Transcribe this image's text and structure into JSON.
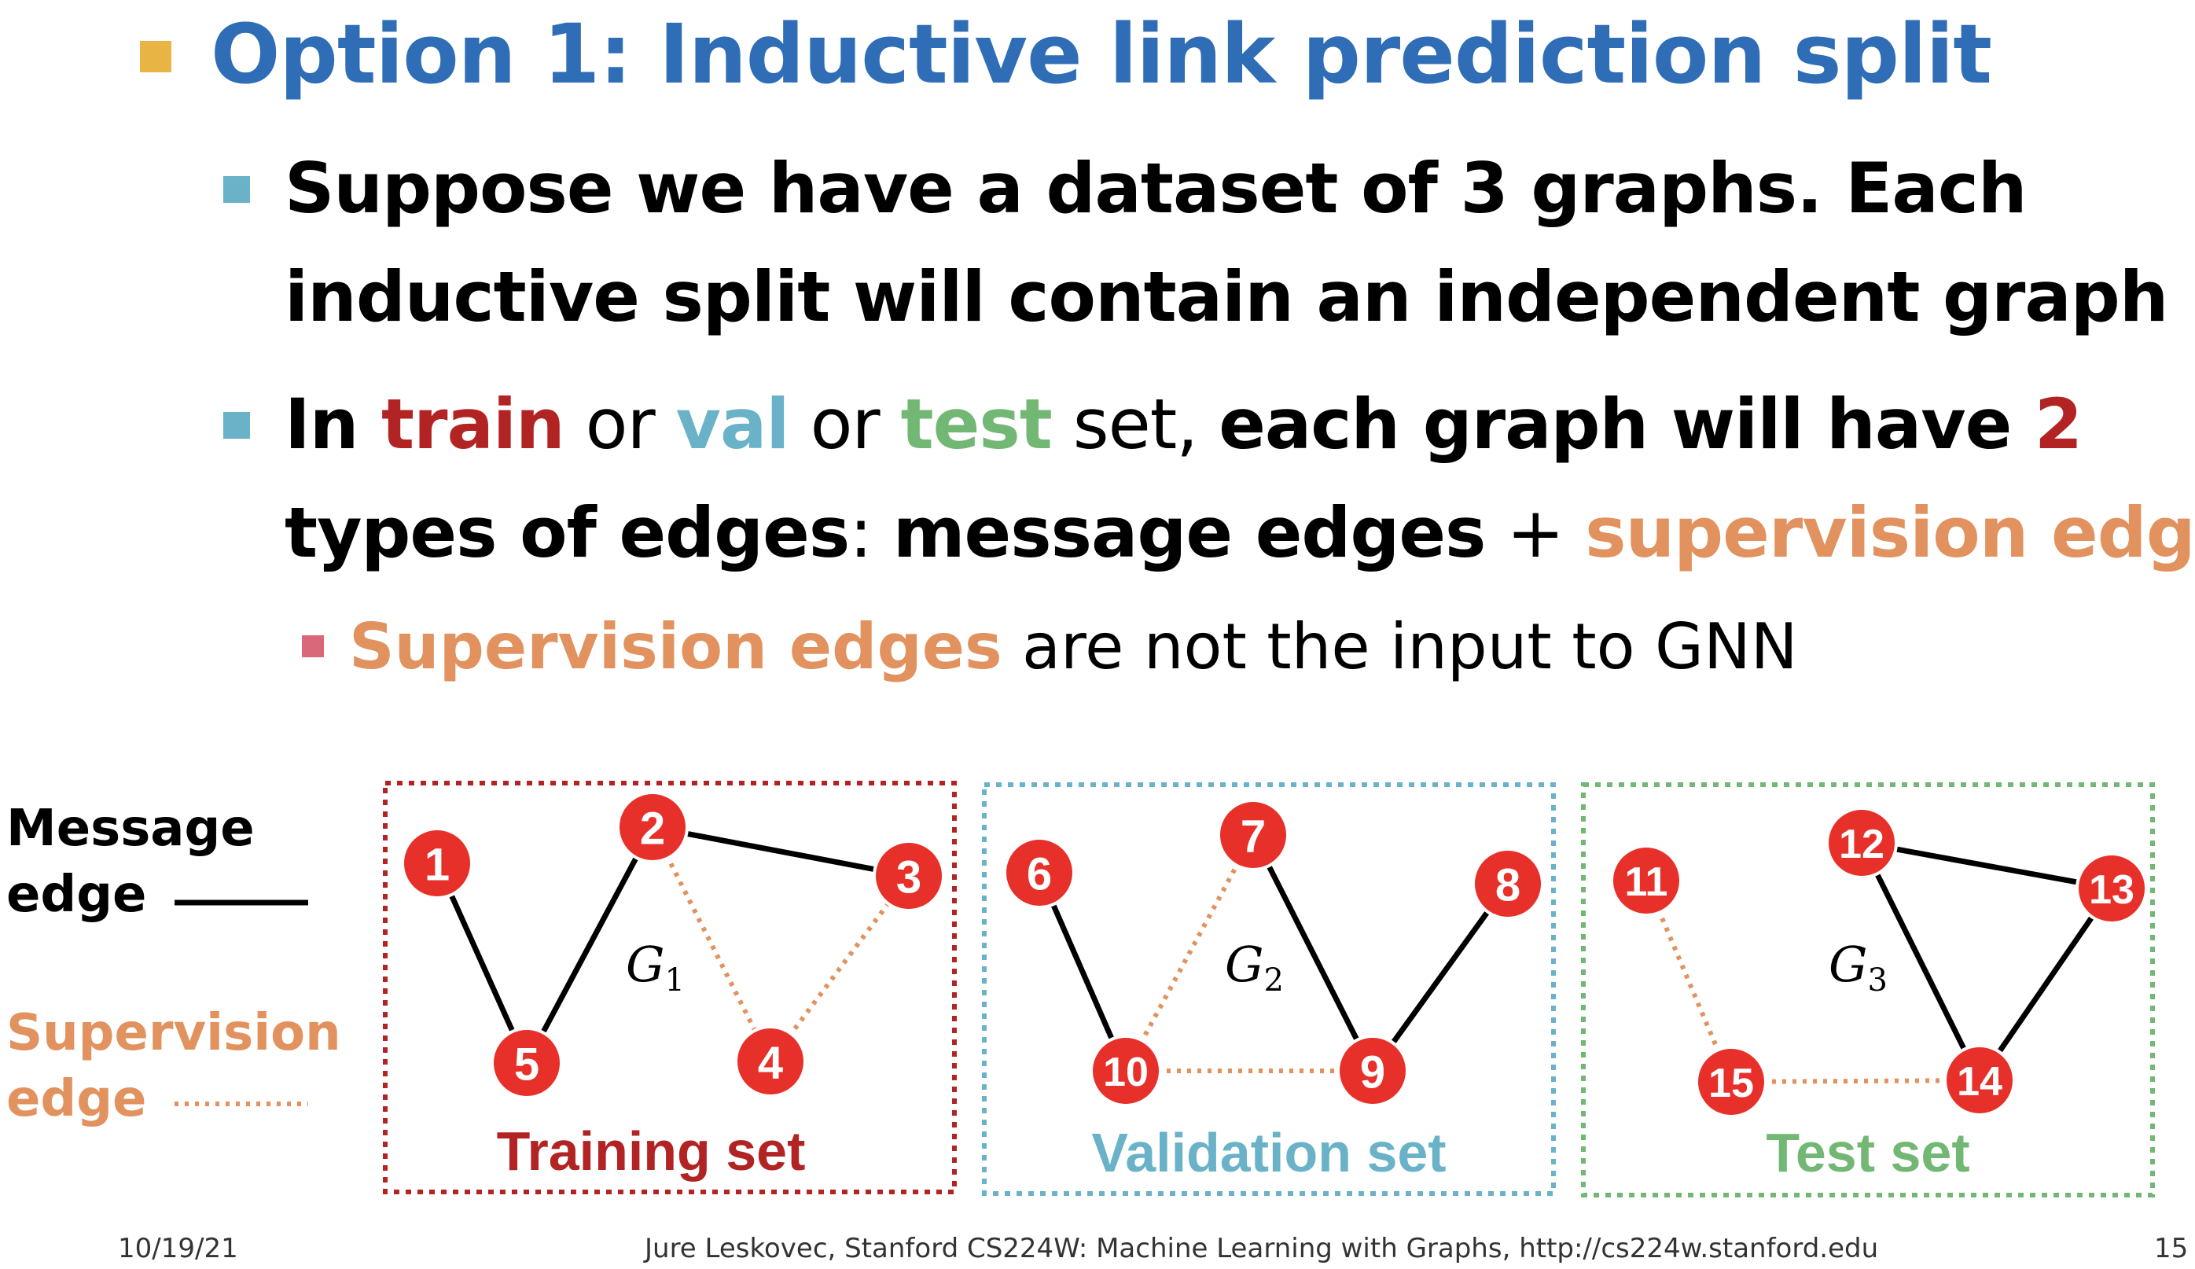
{
  "title": "Option 1: Inductive link prediction split",
  "bullets": {
    "b1_line1": "Suppose we have a dataset of 3 graphs. Each",
    "b1_line2": "inductive split will contain an independent graph",
    "b2_in": "In ",
    "b2_train": "train",
    "b2_or1": " or ",
    "b2_val": "val",
    "b2_or2": " or ",
    "b2_test": "test",
    "b2_set": " set, ",
    "b2_each": "each graph will have ",
    "b2_two": "2",
    "b2_line2a": "types of edges",
    "b2_colon": ": ",
    "b2_message": "message edges",
    "b2_plus": " + ",
    "b2_supervision": "supervision edges",
    "b3_sup": "Supervision edges",
    "b3_rest": " are not the input to GNN"
  },
  "legend": {
    "message_line1": "Message",
    "message_line2": "edge",
    "supervision_line1": "Supervision",
    "supervision_line2": "edge"
  },
  "boxes": {
    "train": "Training set",
    "val": "Validation set",
    "test": "Test set"
  },
  "graph_names": {
    "g1": "G",
    "g1_sub": "1",
    "g2": "G",
    "g2_sub": "2",
    "g3": "G",
    "g3_sub": "3"
  },
  "nodes": [
    "1",
    "2",
    "3",
    "4",
    "5",
    "6",
    "7",
    "8",
    "9",
    "10",
    "11",
    "12",
    "13",
    "14",
    "15"
  ],
  "colors": {
    "title": "#2f6db6",
    "train": "#b22423",
    "val": "#6ab2c8",
    "test": "#72b774",
    "supervision": "#e1925e",
    "node": "#e8302a",
    "bullet_l0": "#e8b545",
    "bullet_l1": "#6ab2c8",
    "bullet_l2": "#d9687a"
  },
  "footer": {
    "date": "10/19/21",
    "credit": "Jure Leskovec, Stanford CS224W: Machine Learning with Graphs, http://cs224w.stanford.edu",
    "page": "15"
  }
}
